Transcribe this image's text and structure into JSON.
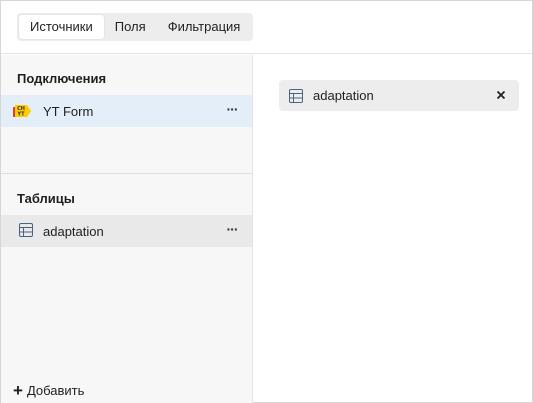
{
  "tabs": [
    {
      "label": "Источники",
      "active": true
    },
    {
      "label": "Поля",
      "active": false
    },
    {
      "label": "Фильтрация",
      "active": false
    }
  ],
  "sidebar": {
    "connections_title": "Подключения",
    "connection": {
      "label": "YT Form",
      "icon": "yt-connection-icon",
      "icon_text": "CH YT"
    },
    "tables_title": "Таблицы",
    "table": {
      "label": "adaptation",
      "icon": "table-icon"
    },
    "add_label": "Добавить"
  },
  "main": {
    "chip": {
      "label": "adaptation",
      "icon": "table-icon"
    }
  },
  "colors": {
    "selected_row": "#e3eef9",
    "table_row": "#e9e9e9",
    "sidebar_bg": "#f7f7f7",
    "yt_badge": "#ffcc00",
    "yt_badge_dot": "#e53935"
  }
}
